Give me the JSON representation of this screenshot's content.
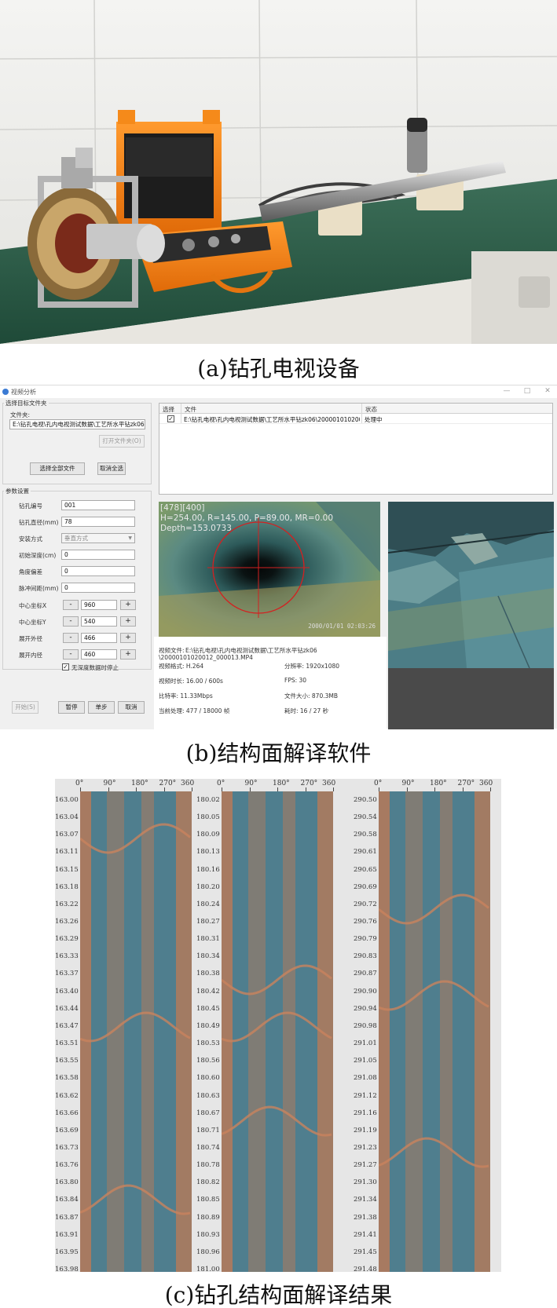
{
  "captions": {
    "a": "(a)钻孔电视设备",
    "b": "(b)结构面解译软件",
    "c": "(c)钻孔结构面解译结果"
  },
  "window": {
    "title": "视频分析",
    "controls": {
      "minimize": "—",
      "maximize": "□",
      "close": "✕"
    }
  },
  "folder_group": {
    "title": "选择目标文件夹",
    "folder_label": "文件夹:",
    "folder_path": "E:\\钻孔电视\\孔内电视测试数据\\工艺所水平钻zk06",
    "open_button": "打开文件夹(O)",
    "select_all_button": "选择全部文件",
    "unselect_button": "取消全选"
  },
  "params": {
    "title": "参数设置",
    "hole_id_label": "钻孔编号",
    "hole_id": "001",
    "diameter_label": "钻孔直径(mm)",
    "diameter": "78",
    "install_label": "安装方式",
    "install": "垂直方式",
    "init_depth_label": "初始深度(cm)",
    "init_depth": "0",
    "angle_label": "角度偏差",
    "angle": "0",
    "pulse_label": "脉冲间距(mm)",
    "pulse": "0",
    "center_x_label": "中心坐标X",
    "center_x": "960",
    "center_y_label": "中心坐标Y",
    "center_y": "540",
    "outer_label": "展开外径",
    "outer": "466",
    "inner_label": "展开内径",
    "inner": "460",
    "minus": "-",
    "plus": "+",
    "stop_check_label": "无深度数据时停止"
  },
  "bottom_buttons": {
    "start": "开始(S)",
    "pause": "暂停",
    "step": "单步",
    "cancel": "取消"
  },
  "file_table": {
    "headers": [
      "选择",
      "文件",
      "状态"
    ],
    "row": {
      "file": "E:\\钻孔电视\\孔内电视测试数据\\工艺所水平钻zk06\\20000101020012_000",
      "status": "处理中"
    }
  },
  "video_overlay": {
    "line1": "[478][400]",
    "line2": "H=254.00, R=145.00, P=89.00, MR=0.00",
    "line3": "Depth=153.0733",
    "timestamp": "2000/01/01 02:03:26"
  },
  "video_info": {
    "file_label": "视频文件:",
    "file_line1": "E:\\钻孔电视\\孔内电视测试数据\\工艺所水平钻zk06",
    "file_line2": "\\20000101020012_000013.MP4",
    "format": "视频格式: H.264",
    "resolution": "分辨率: 1920x1080",
    "duration": "视频时长: 16.00 / 600s",
    "fps": "FPS: 30",
    "bitrate": "比特率: 11.33Mbps",
    "filesize": "文件大小: 870.3MB",
    "progress": "当前处理: 477 / 18000 帧",
    "elapsed": "耗时: 16 / 27 秒"
  },
  "logs": {
    "angle_ticks": [
      "0°",
      "90°",
      "180°",
      "270°",
      "360"
    ],
    "columns": [
      {
        "depths": [
          "163.00",
          "163.04",
          "163.07",
          "163.11",
          "163.15",
          "163.18",
          "163.22",
          "163.26",
          "163.29",
          "163.33",
          "163.37",
          "163.40",
          "163.44",
          "163.47",
          "163.51",
          "163.55",
          "163.58",
          "163.62",
          "163.66",
          "163.69",
          "163.73",
          "163.76",
          "163.80",
          "163.84",
          "163.87",
          "163.91",
          "163.95",
          "163.98"
        ]
      },
      {
        "depths": [
          "180.02",
          "180.05",
          "180.09",
          "180.13",
          "180.16",
          "180.20",
          "180.24",
          "180.27",
          "180.31",
          "180.34",
          "180.38",
          "180.42",
          "180.45",
          "180.49",
          "180.53",
          "180.56",
          "180.60",
          "180.63",
          "180.67",
          "180.71",
          "180.74",
          "180.78",
          "180.82",
          "180.85",
          "180.89",
          "180.93",
          "180.96",
          "181.00"
        ]
      },
      {
        "depths": [
          "290.50",
          "290.54",
          "290.58",
          "290.61",
          "290.65",
          "290.69",
          "290.72",
          "290.76",
          "290.79",
          "290.83",
          "290.87",
          "290.90",
          "290.94",
          "290.98",
          "291.01",
          "291.05",
          "291.08",
          "291.12",
          "291.16",
          "291.19",
          "291.23",
          "291.27",
          "291.30",
          "291.34",
          "291.38",
          "291.41",
          "291.45",
          "291.48"
        ]
      }
    ]
  },
  "colors": {
    "table_green": "#2f5f4a",
    "crosshair_red": "#d42020",
    "log_brown": "#b07a5c",
    "log_blue": "#4f7e8e"
  }
}
